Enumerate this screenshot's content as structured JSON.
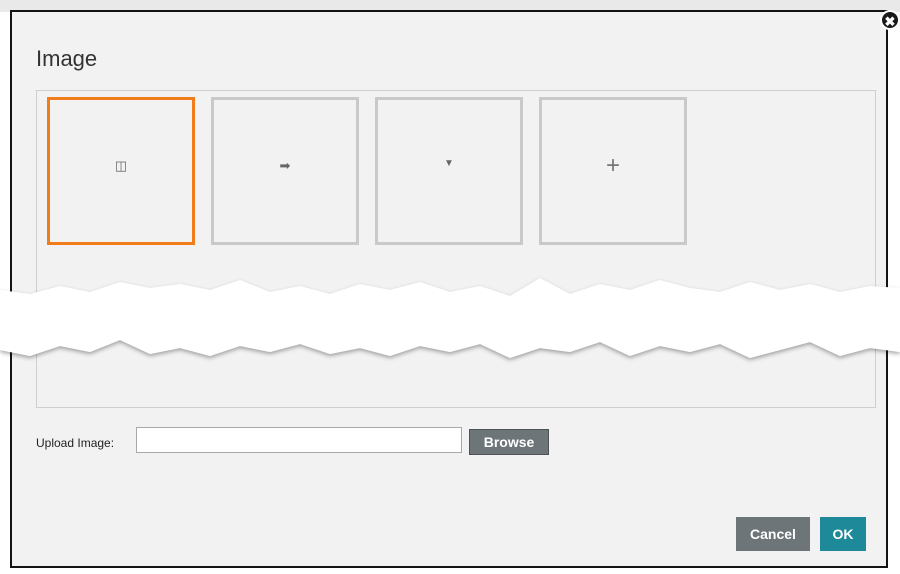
{
  "dialog": {
    "title": "Image",
    "close_icon": "close-icon",
    "tiles": [
      {
        "icon": "book-icon",
        "selected": true
      },
      {
        "icon": "export-icon",
        "selected": false
      },
      {
        "icon": "dropdown-arrow-icon",
        "selected": false
      },
      {
        "icon": "plus-icon",
        "selected": false
      }
    ],
    "upload": {
      "label": "Upload Image:",
      "value": "",
      "browse_label": "Browse"
    },
    "footer": {
      "cancel_label": "Cancel",
      "ok_label": "OK"
    }
  },
  "colors": {
    "selected_border": "#f07d1a",
    "ok_button": "#1e8a99",
    "secondary_button": "#6e7578"
  }
}
